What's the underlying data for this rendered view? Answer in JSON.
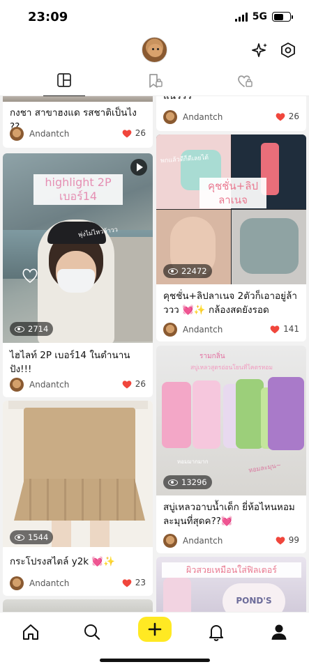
{
  "status_bar": {
    "time": "23:09",
    "network": "5G",
    "battery_level": 0.6
  },
  "tabs": [
    {
      "name": "feed",
      "icon": "grid-layout-icon",
      "active": true
    },
    {
      "name": "saved",
      "icon": "bookmark-lock-icon",
      "active": false
    },
    {
      "name": "liked",
      "icon": "heart-lock-icon",
      "active": false
    }
  ],
  "colors": {
    "accent_yellow": "#ffe923",
    "heart_red": "#f0463c",
    "text_dark": "#111111"
  },
  "left_column": [
    {
      "title": "กงชา สาขาฮงแด รสชาติเป็นไง ??",
      "author": "Andantch",
      "likes": "26"
    },
    {
      "overlay_line1": "highlight 2P",
      "overlay_line2": "เบอร์14",
      "handwritten": "พุ่งไม่ไหวล้าวว",
      "views": "2714",
      "title": "ไฮไลท์ 2P เบอร์14 ในตำนาน ปัง!!!",
      "author": "Andantch",
      "likes": "26"
    },
    {
      "views": "1544",
      "title": "กระโปรงสไตล์ y2k 💓✨",
      "author": "Andantch",
      "likes": "23"
    }
  ],
  "right_column": [
    {
      "title": "แนววว",
      "author": "Andantch",
      "likes": "26"
    },
    {
      "overlay_top": "พกแล้วดีก็ดีเลยได้",
      "overlay_line1": "คุชชั่น+ลิป",
      "overlay_line2": "ลาเนจ",
      "views": "22472",
      "title": "คุชชั่น+ลิปลาเนจ 2ตัวก็เอาอยู่ล้าววว 💓✨ กล้องสดยังรอด",
      "author": "Andantch",
      "likes": "141"
    },
    {
      "overlay_top1": "รามกลิ่น",
      "overlay_top2": "สบู่เหลวสูตรอ่อนโยนที่โคตรหอม",
      "overlay_bottom": "หอมละมุน~",
      "overlay_left": "หอมมากมาก",
      "views": "13296",
      "title": "สบู่เหลวอาบน้ำเด็ก ยี่ห้อไหนหอม ละมุนที่สุดค??💓",
      "author": "Andantch",
      "likes": "99"
    },
    {
      "overlay_line1": "ผิวสวยเหมือนใส่ฟิลเตอร์",
      "brand": "POND'S"
    }
  ]
}
